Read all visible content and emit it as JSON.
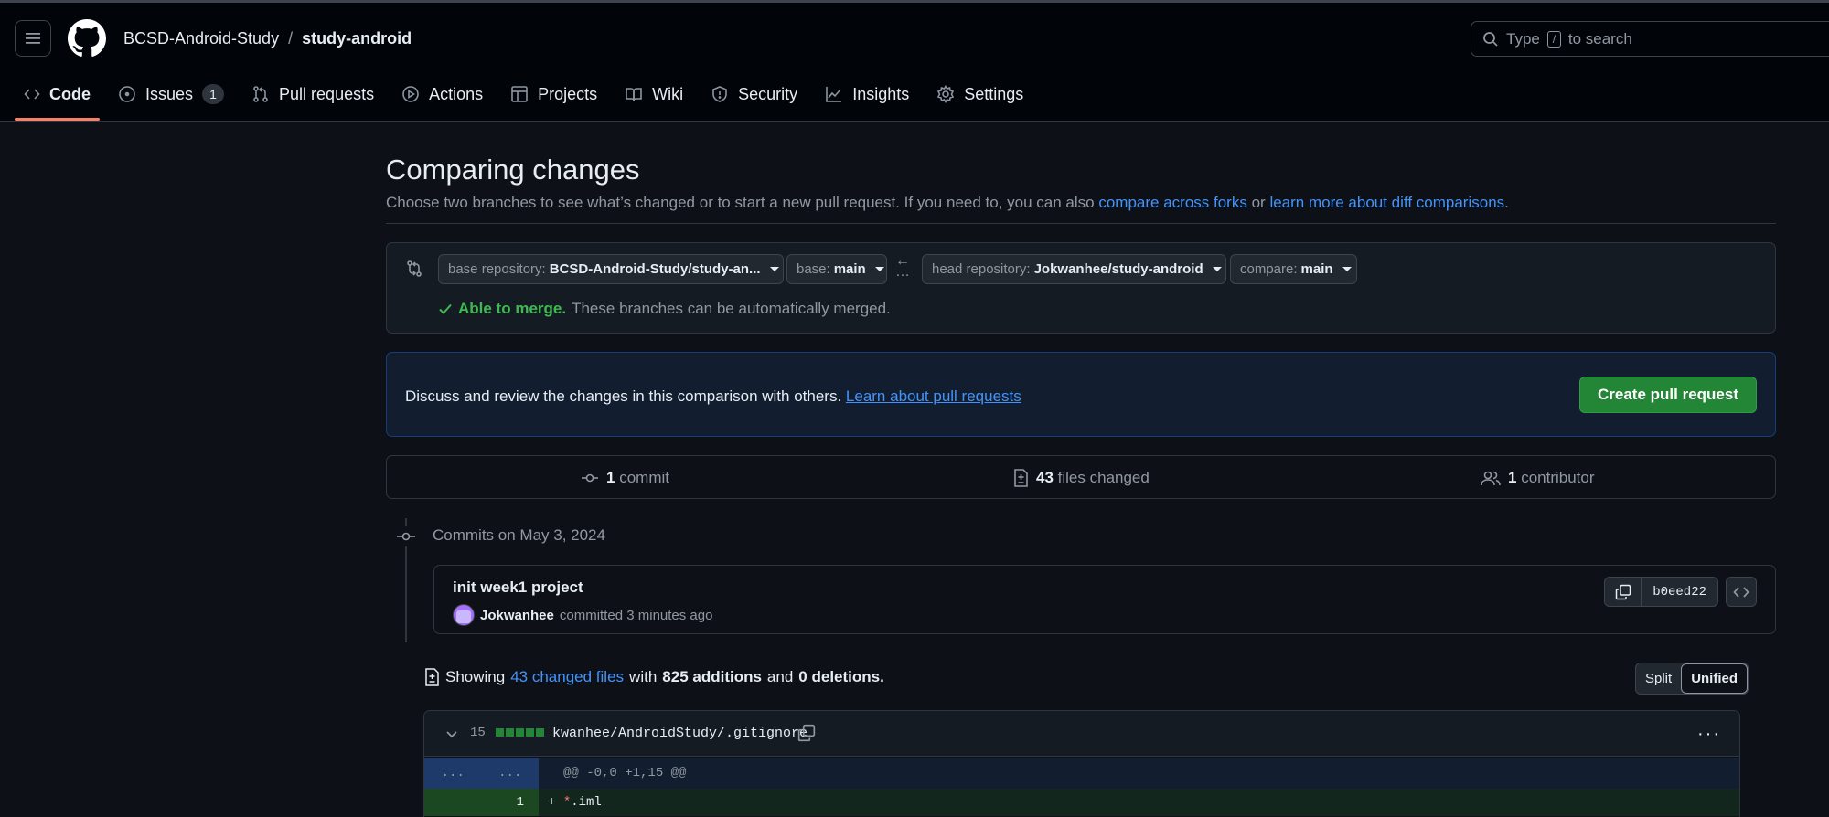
{
  "header": {
    "owner": "BCSD-Android-Study",
    "separator": "/",
    "repo": "study-android",
    "search_before": "Type",
    "search_key": "/",
    "search_after": "to search"
  },
  "tabs": [
    {
      "label": "Code",
      "icon": "code-icon"
    },
    {
      "label": "Issues",
      "icon": "issue-icon",
      "count": "1"
    },
    {
      "label": "Pull requests",
      "icon": "pull-request-icon"
    },
    {
      "label": "Actions",
      "icon": "play-icon"
    },
    {
      "label": "Projects",
      "icon": "table-icon"
    },
    {
      "label": "Wiki",
      "icon": "book-icon"
    },
    {
      "label": "Security",
      "icon": "shield-icon"
    },
    {
      "label": "Insights",
      "icon": "graph-icon"
    },
    {
      "label": "Settings",
      "icon": "gear-icon"
    }
  ],
  "page": {
    "title": "Comparing changes",
    "subtitle_text": "Choose two branches to see what’s changed or to start a new pull request. If you need to, you can also",
    "link_compare_forks": "compare across forks",
    "subtitle_or": "or",
    "link_learn_diff": "learn more about diff comparisons",
    "subtitle_end": "."
  },
  "range": {
    "base_repo_label": "base repository:",
    "base_repo_value": "BCSD-Android-Study/study-an...",
    "base_label": "base:",
    "base_value": "main",
    "head_repo_label": "head repository:",
    "head_repo_value": "Jokwanhee/study-android",
    "compare_label": "compare:",
    "compare_value": "main",
    "merge_ok": "Able to merge.",
    "merge_text": "These branches can be automatically merged."
  },
  "discuss": {
    "text": "Discuss and review the changes in this comparison with others.",
    "link": "Learn about pull requests",
    "button": "Create pull request"
  },
  "stats": {
    "commits_count": "1",
    "commits_label": "commit",
    "files_count": "43",
    "files_label": "files changed",
    "contributors_count": "1",
    "contributors_label": "contributor"
  },
  "commits": {
    "date_heading": "Commits on May 3, 2024",
    "title": "init week1 project",
    "author": "Jokwanhee",
    "meta": "committed 3 minutes ago",
    "sha": "b0eed22"
  },
  "summary": {
    "showing": "Showing",
    "changed_files": "43 changed files",
    "with": "with",
    "additions": "825 additions",
    "and": "and",
    "deletions": "0 deletions."
  },
  "view_toggle": {
    "split": "Split",
    "unified": "Unified",
    "selected": "Unified"
  },
  "file": {
    "count": "15",
    "name": "kwanhee/AndroidStudy/.gitignore",
    "hunk_left": "...",
    "hunk_right": "...",
    "hunk_header": "@@ -0,0 +1,15 @@",
    "line_number": "1",
    "line_prefix": "+",
    "line_star": "*",
    "line_rest": ".iml"
  },
  "colors": {
    "accent": "#f78166",
    "link": "#4493f8",
    "success": "#3fb950",
    "button_green": "#238636"
  }
}
